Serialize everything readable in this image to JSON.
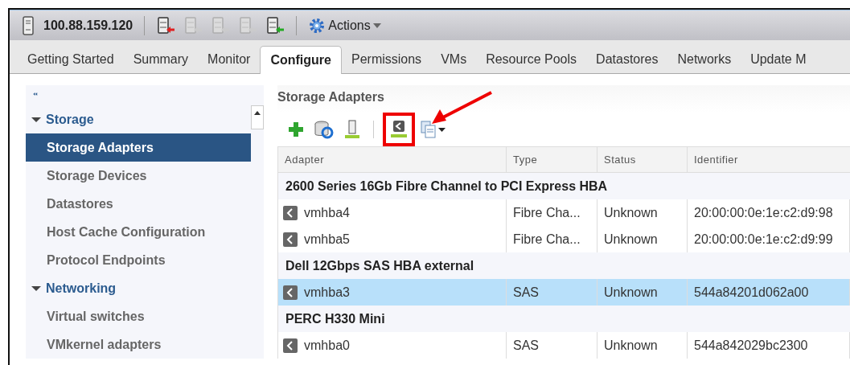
{
  "header": {
    "host": "100.88.159.120",
    "actions": [
      {
        "disabled": false
      },
      {
        "disabled": true
      },
      {
        "disabled": true
      },
      {
        "disabled": true
      },
      {
        "disabled": false
      }
    ],
    "menu": "Actions"
  },
  "tabs": [
    {
      "label": "Getting Started",
      "selected": false
    },
    {
      "label": "Summary",
      "selected": false
    },
    {
      "label": "Monitor",
      "selected": false
    },
    {
      "label": "Configure",
      "selected": true
    },
    {
      "label": "Permissions",
      "selected": false
    },
    {
      "label": "VMs",
      "selected": false
    },
    {
      "label": "Resource Pools",
      "selected": false
    },
    {
      "label": "Datastores",
      "selected": false
    },
    {
      "label": "Networks",
      "selected": false
    },
    {
      "label": "Update M",
      "selected": false
    }
  ],
  "sidebar": {
    "sections": [
      {
        "label": "Storage",
        "expanded": true,
        "children": [
          {
            "label": "Storage Adapters",
            "selected": true
          },
          {
            "label": "Storage Devices",
            "selected": false
          },
          {
            "label": "Datastores",
            "selected": false
          },
          {
            "label": "Host Cache Configuration",
            "selected": false
          },
          {
            "label": "Protocol Endpoints",
            "selected": false
          }
        ]
      },
      {
        "label": "Networking",
        "expanded": true,
        "children": [
          {
            "label": "Virtual switches",
            "selected": false
          },
          {
            "label": "VMkernel adapters",
            "selected": false
          }
        ]
      }
    ]
  },
  "panel": {
    "title": "Storage Adapters"
  },
  "table": {
    "columns": [
      "Adapter",
      "Type",
      "Status",
      "Identifier"
    ],
    "rows": [
      {
        "kind": "group",
        "label": "2600 Series 16Gb Fibre Channel to PCI Express HBA"
      },
      {
        "kind": "adapter",
        "selected": false,
        "cells": [
          "vmhba4",
          "Fibre Cha...",
          "Unknown",
          "20:00:00:0e:1e:c2:d9:98"
        ]
      },
      {
        "kind": "adapter",
        "selected": false,
        "cells": [
          "vmhba5",
          "Fibre Cha...",
          "Unknown",
          "20:00:00:0e:1e:c2:d9:99"
        ]
      },
      {
        "kind": "group",
        "label": "Dell 12Gbps SAS HBA external"
      },
      {
        "kind": "adapter",
        "selected": true,
        "cells": [
          "vmhba3",
          "SAS",
          "Unknown",
          "544a84201d062a00"
        ]
      },
      {
        "kind": "group",
        "label": "PERC H330 Mini"
      },
      {
        "kind": "adapter",
        "selected": false,
        "cells": [
          "vmhba0",
          "SAS",
          "Unknown",
          "544a842029bc2300"
        ]
      }
    ]
  }
}
